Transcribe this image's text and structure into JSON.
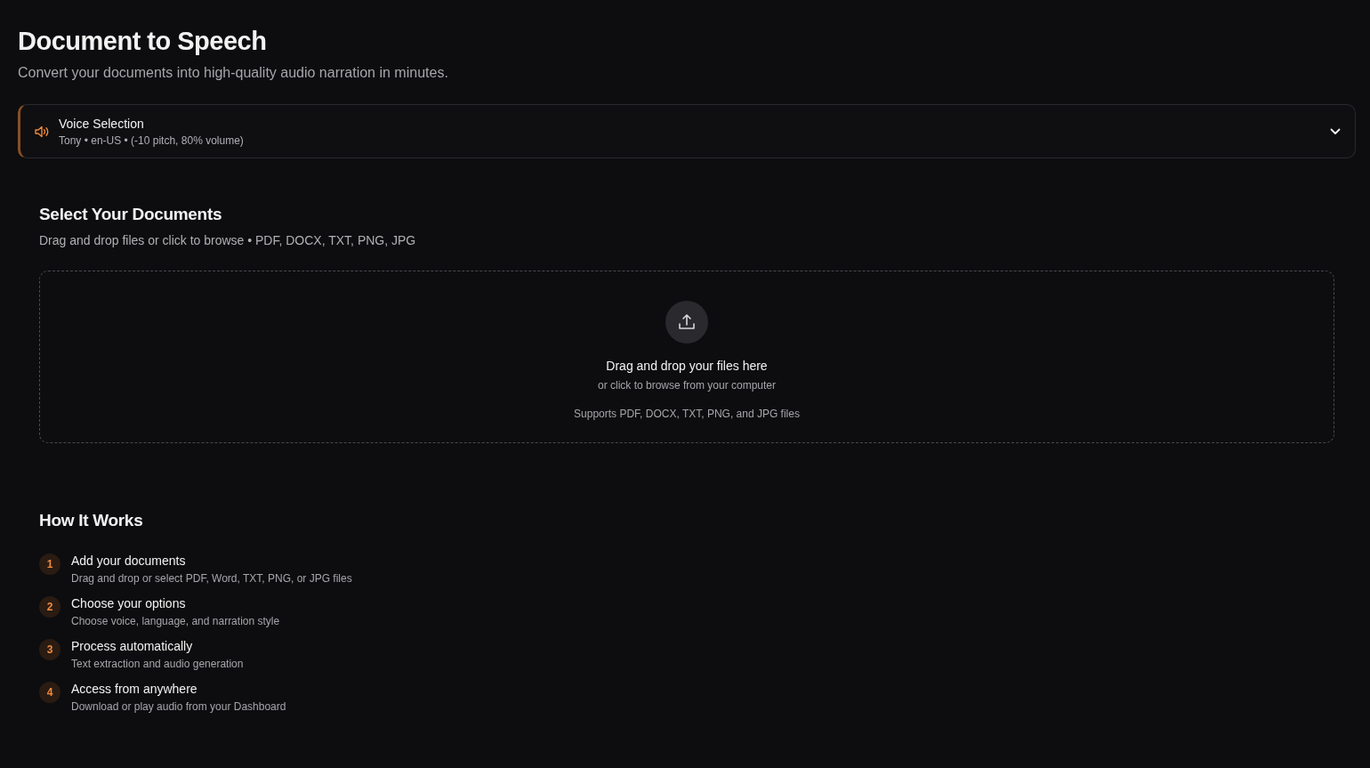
{
  "header": {
    "title": "Document to Speech",
    "subtitle": "Convert your documents into high-quality audio narration in minutes."
  },
  "voice_selection": {
    "title": "Voice Selection",
    "summary": "Tony • en-US • (-10 pitch, 80% volume)",
    "expanded": false
  },
  "documents": {
    "title": "Select Your Documents",
    "subtitle": "Drag and drop files or click to browse • PDF, DOCX, TXT, PNG, JPG",
    "dropzone": {
      "heading": "Drag and drop your files here",
      "hint": "or click to browse from your computer",
      "supported": "Supports PDF, DOCX, TXT, PNG, and JPG files"
    }
  },
  "how_it_works": {
    "title": "How It Works",
    "steps": [
      {
        "number": "1",
        "title": "Add your documents",
        "description": "Drag and drop or select PDF, Word, TXT, PNG, or JPG files"
      },
      {
        "number": "2",
        "title": "Choose your options",
        "description": "Choose voice, language, and narration style"
      },
      {
        "number": "3",
        "title": "Process automatically",
        "description": "Text extraction and audio generation"
      },
      {
        "number": "4",
        "title": "Access from anywhere",
        "description": "Download or play audio from your Dashboard"
      }
    ]
  }
}
